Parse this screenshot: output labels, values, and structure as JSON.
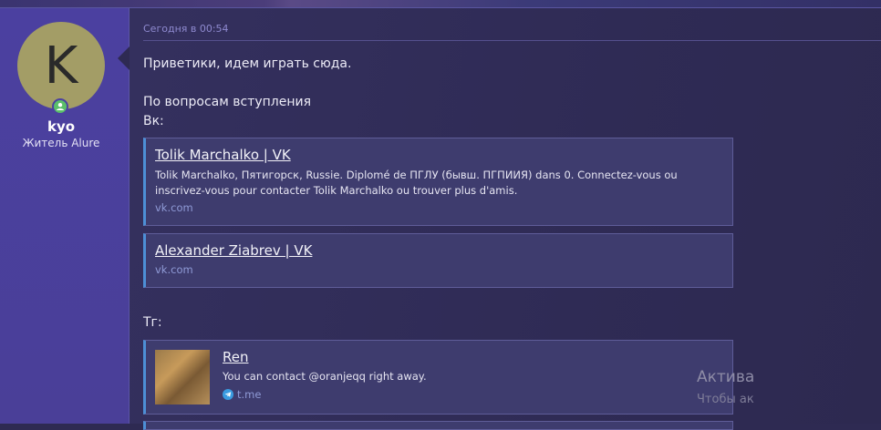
{
  "author": {
    "avatar_letter": "K",
    "name": "kyo",
    "title": "Житель Alure"
  },
  "post": {
    "date": "Сегодня в 00:54",
    "line1": "Приветики, идем играть сюда.",
    "line2": "По вопросам вступления",
    "vk_label": "Вк:",
    "tg_label": "Тг:"
  },
  "cards": {
    "vk1": {
      "title": "Tolik Marchalko | VK",
      "description": "Tolik Marchalko, Пятигорск, Russie. Diplomé de ПГЛУ (бывш. ПГПИИЯ) dans 0. Connectez-vous ou inscrivez-vous pour contacter Tolik Marchalko ou trouver plus d'amis.",
      "domain": "vk.com"
    },
    "vk2": {
      "title": "Alexander Ziabrev | VK",
      "domain": "vk.com"
    },
    "tg": {
      "title": "Ren",
      "description": "You can contact @oranjeqq right away.",
      "domain": "t.me"
    }
  },
  "overlay": {
    "activation_title": "Актива",
    "activation_sub": "Чтобы ак"
  },
  "colors": {
    "sidebar": "#4b40a0",
    "main_bg": "#2f2b55",
    "card_accent": "#4d8fd6",
    "online_status": "#5bbf6a"
  }
}
